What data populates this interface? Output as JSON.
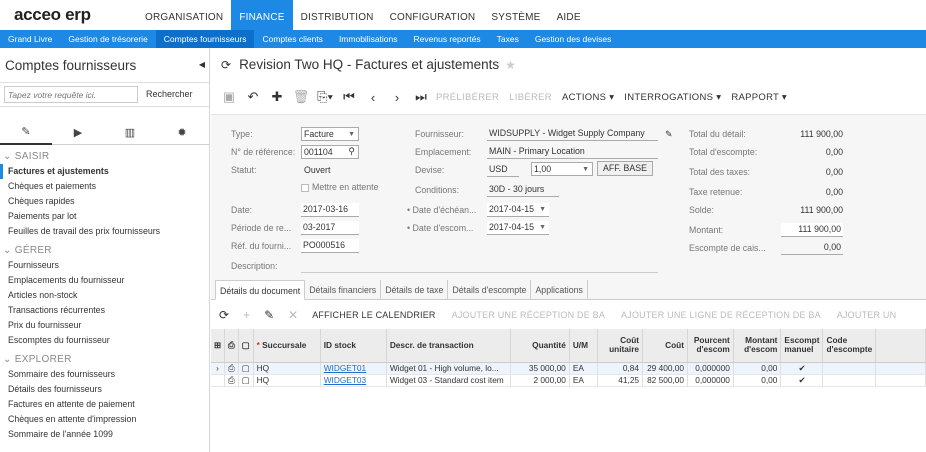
{
  "app": {
    "logo": "acceo erp",
    "menu": [
      "ORGANISATION",
      "FINANCE",
      "DISTRIBUTION",
      "CONFIGURATION",
      "SYSTÈME",
      "AIDE"
    ],
    "submenu": [
      "Grand Livre",
      "Gestion de trésorerie",
      "Comptes fournisseurs",
      "Comptes clients",
      "Immobilisations",
      "Revenus reportés",
      "Taxes",
      "Gestion des devises"
    ]
  },
  "sidebar": {
    "title": "Comptes fournisseurs",
    "search_placeholder": "Tapez votre requête ici.",
    "search_button": "Rechercher",
    "sections": [
      {
        "label": "SAISIR",
        "items": [
          "Factures et ajustements",
          "Chèques et paiements",
          "Chèques rapides",
          "Paiements par lot",
          "Feuilles de travail des prix fournisseurs"
        ]
      },
      {
        "label": "GÉRER",
        "items": [
          "Fournisseurs",
          "Emplacements du fournisseur",
          "Articles non-stock",
          "Transactions récurrentes",
          "Prix du fournisseur",
          "Escomptes du fournisseur"
        ]
      },
      {
        "label": "EXPLORER",
        "items": [
          "Sommaire des fournisseurs",
          "Détails des fournisseurs",
          "Factures en attente de paiement",
          "Chèques en attente d'impression",
          "Sommaire de l'année 1099"
        ]
      }
    ]
  },
  "page": {
    "title": "Revision Two HQ - Factures et ajustements",
    "toolbar": {
      "prelib": "PRÉLIBÉRER",
      "lib": "LIBÉRER",
      "actions": "ACTIONS ▾",
      "interrogations": "INTERROGATIONS ▾",
      "rapport": "RAPPORT ▾"
    }
  },
  "form": {
    "type_label": "Type:",
    "type_value": "Facture",
    "ref_label": "N° de référence:",
    "ref_value": "001104",
    "statut_label": "Statut:",
    "statut_value": "Ouvert",
    "hold_label": "Mettre en attente",
    "date_label": "Date:",
    "date_value": "2017-03-16",
    "periode_label": "Période de re...",
    "periode_value": "03-2017",
    "reffour_label": "Réf. du fourni...",
    "reffour_value": "PO000516",
    "desc_label": "Description:",
    "fournisseur_label": "Fournisseur:",
    "fournisseur_value": "WIDSUPPLY - Widget Supply Company",
    "empl_label": "Emplacement:",
    "empl_value": "MAIN - Primary Location",
    "devise_label": "Devise:",
    "devise_value": "USD",
    "devise_rate": "1,00",
    "aff_base": "AFF. BASE",
    "cond_label": "Conditions:",
    "cond_value": "30D - 30 jours",
    "echeance_label": "• Date d'échéan...",
    "echeance_value": "2017-04-15",
    "escompte_label": "• Date d'escom...",
    "escompte_value": "2017-04-15",
    "total_detail_label": "Total du détail:",
    "total_detail_value": "111 900,00",
    "total_escompte_label": "Total d'escompte:",
    "total_escompte_value": "0,00",
    "total_taxes_label": "Total des taxes:",
    "total_taxes_value": "0,00",
    "taxe_ret_label": "Taxe retenue:",
    "taxe_ret_value": "0,00",
    "solde_label": "Solde:",
    "solde_value": "111 900,00",
    "montant_label": "Montant:",
    "montant_value": "111 900,00",
    "esc_caisse_label": "Escompte de cais...",
    "esc_caisse_value": "0,00"
  },
  "tabs": [
    "Détails du document",
    "Détails financiers",
    "Détails de taxe",
    "Détails d'escompte",
    "Applications"
  ],
  "grid_toolbar": {
    "calendar": "AFFICHER LE CALENDRIER",
    "add_receipt": "AJOUTER UNE RÉCEPTION DE BA",
    "add_receipt_line": "AJOUTER UNE LIGNE DE RÉCEPTION DE BA",
    "add_more": "AJOUTER UN"
  },
  "grid": {
    "headers": [
      "Succursale",
      "ID stock",
      "Descr. de transaction",
      "Quantité",
      "U/M",
      "Coût unitaire",
      "Coût",
      "Pourcent d'escom",
      "Montant d'escom",
      "Escompt manuel",
      "Code d'escompte"
    ],
    "required_marker": "*",
    "rows": [
      {
        "succursale": "HQ",
        "stock": "WIDGET01",
        "descr": "Widget 01 - High volume, lo...",
        "qty": "35 000,00",
        "um": "EA",
        "cu": "0,84",
        "cout": "29 400,00",
        "pct": "0,000000",
        "mnt": "0,00",
        "manuel": "✔",
        "code": ""
      },
      {
        "succursale": "HQ",
        "stock": "WIDGET03",
        "descr": "Widget 03 - Standard cost item",
        "qty": "2 000,00",
        "um": "EA",
        "cu": "41,25",
        "cout": "82 500,00",
        "pct": "0,000000",
        "mnt": "0,00",
        "manuel": "✔",
        "code": ""
      }
    ]
  }
}
